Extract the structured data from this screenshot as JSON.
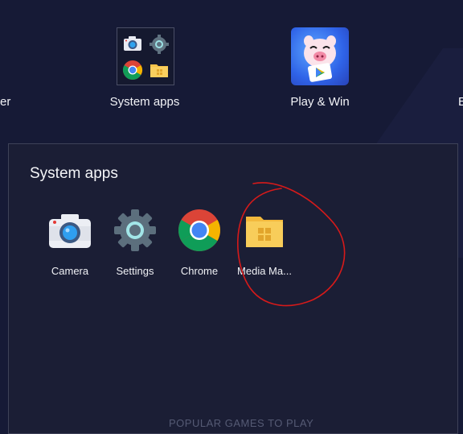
{
  "desktop": {
    "partial_left_label": "er",
    "partial_right_label": "E",
    "system_apps_folder": {
      "label": "System apps"
    },
    "play_win": {
      "label": "Play & Win"
    }
  },
  "folder_panel": {
    "title": "System apps",
    "apps": [
      {
        "label": "Camera",
        "icon": "camera-icon"
      },
      {
        "label": "Settings",
        "icon": "gear-icon"
      },
      {
        "label": "Chrome",
        "icon": "chrome-icon"
      },
      {
        "label": "Media Ma...",
        "icon": "folder-icon"
      }
    ]
  },
  "footer": {
    "text": "POPULAR GAMES TO PLAY"
  },
  "colors": {
    "background": "#161a36",
    "panel": "#1b1e35",
    "folder_yellow": "#f6c34a",
    "annotation_red": "#d61a1a"
  }
}
